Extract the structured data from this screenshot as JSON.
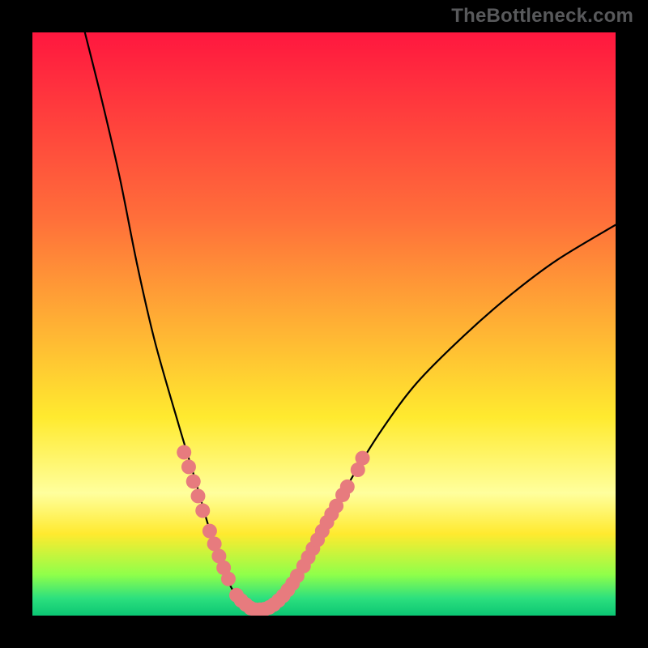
{
  "branding": "TheBottleneck.com",
  "colors": {
    "marker": "#e77b7e",
    "curve": "#000000",
    "grad_top": "#ff173f",
    "grad_mid1": "#ff6f3a",
    "grad_mid2": "#ffea2f",
    "grad_low_hl": "#ffff9d",
    "grad_green1": "#8fff4a",
    "grad_green2": "#2de07e",
    "grad_bottom": "#0bc673"
  },
  "chart_data": {
    "type": "line",
    "title": "",
    "xlabel": "",
    "ylabel": "",
    "xlim": [
      0,
      100
    ],
    "ylim": [
      0,
      100
    ],
    "legend": false,
    "grid": false,
    "curve": [
      {
        "x": 9,
        "y": 100
      },
      {
        "x": 12,
        "y": 88
      },
      {
        "x": 15,
        "y": 75
      },
      {
        "x": 18,
        "y": 60
      },
      {
        "x": 21,
        "y": 47
      },
      {
        "x": 25,
        "y": 33
      },
      {
        "x": 28,
        "y": 23
      },
      {
        "x": 30,
        "y": 16
      },
      {
        "x": 32,
        "y": 10
      },
      {
        "x": 34,
        "y": 5
      },
      {
        "x": 36,
        "y": 2
      },
      {
        "x": 38,
        "y": 1
      },
      {
        "x": 40,
        "y": 1
      },
      {
        "x": 42,
        "y": 2
      },
      {
        "x": 44,
        "y": 4
      },
      {
        "x": 47,
        "y": 9
      },
      {
        "x": 50,
        "y": 15
      },
      {
        "x": 55,
        "y": 24
      },
      {
        "x": 60,
        "y": 32
      },
      {
        "x": 66,
        "y": 40
      },
      {
        "x": 74,
        "y": 48
      },
      {
        "x": 82,
        "y": 55
      },
      {
        "x": 90,
        "y": 61
      },
      {
        "x": 100,
        "y": 67
      }
    ],
    "markers": [
      {
        "x": 26.0,
        "y": 28.0
      },
      {
        "x": 26.8,
        "y": 25.5
      },
      {
        "x": 27.6,
        "y": 23.0
      },
      {
        "x": 28.4,
        "y": 20.5
      },
      {
        "x": 29.2,
        "y": 18.0
      },
      {
        "x": 30.4,
        "y": 14.5
      },
      {
        "x": 31.2,
        "y": 12.3
      },
      {
        "x": 32.0,
        "y": 10.2
      },
      {
        "x": 32.8,
        "y": 8.2
      },
      {
        "x": 33.6,
        "y": 6.3
      },
      {
        "x": 35.0,
        "y": 3.5
      },
      {
        "x": 35.8,
        "y": 2.6
      },
      {
        "x": 36.6,
        "y": 1.9
      },
      {
        "x": 37.4,
        "y": 1.3
      },
      {
        "x": 38.2,
        "y": 1.0
      },
      {
        "x": 39.0,
        "y": 1.0
      },
      {
        "x": 39.8,
        "y": 1.1
      },
      {
        "x": 40.6,
        "y": 1.4
      },
      {
        "x": 41.4,
        "y": 1.9
      },
      {
        "x": 42.2,
        "y": 2.6
      },
      {
        "x": 43.0,
        "y": 3.4
      },
      {
        "x": 43.8,
        "y": 4.4
      },
      {
        "x": 44.6,
        "y": 5.5
      },
      {
        "x": 45.4,
        "y": 6.8
      },
      {
        "x": 46.5,
        "y": 8.5
      },
      {
        "x": 47.3,
        "y": 10.0
      },
      {
        "x": 48.1,
        "y": 11.5
      },
      {
        "x": 48.9,
        "y": 13.0
      },
      {
        "x": 49.7,
        "y": 14.5
      },
      {
        "x": 50.5,
        "y": 16.0
      },
      {
        "x": 51.3,
        "y": 17.4
      },
      {
        "x": 52.1,
        "y": 18.8
      },
      {
        "x": 53.2,
        "y": 20.7
      },
      {
        "x": 54.0,
        "y": 22.1
      },
      {
        "x": 55.8,
        "y": 25.0
      },
      {
        "x": 56.6,
        "y": 27.0
      }
    ]
  }
}
